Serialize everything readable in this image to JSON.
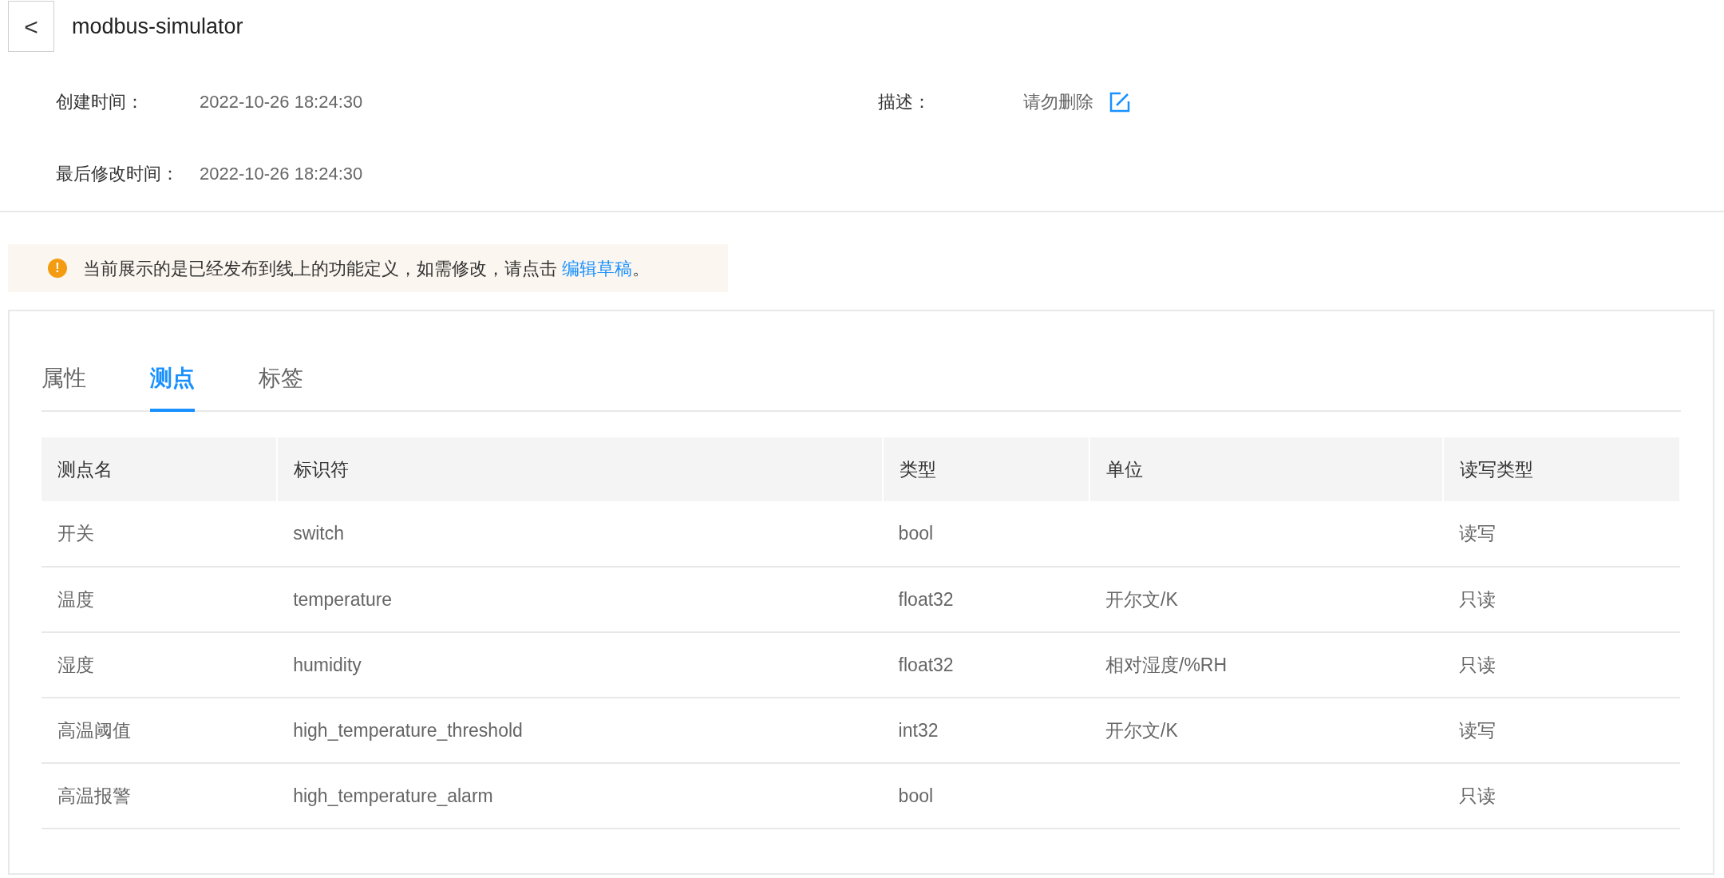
{
  "header": {
    "back_button": "<",
    "title": "modbus-simulator"
  },
  "info": [
    {
      "label": "创建时间：",
      "value": "2022-10-26 18:24:30"
    },
    {
      "label": "描述：",
      "value": "请勿删除",
      "editable": true
    },
    {
      "label": "最后修改时间：",
      "value": "2022-10-26 18:24:30"
    }
  ],
  "notice": {
    "icon": "!",
    "text": "当前展示的是已经发布到线上的功能定义，如需修改，请点击 ",
    "link": "编辑草稿",
    "suffix": "。"
  },
  "tabs": [
    {
      "label": "属性",
      "selected": false
    },
    {
      "label": "测点",
      "selected": true
    },
    {
      "label": "标签",
      "selected": false
    }
  ],
  "table": {
    "columns": [
      "测点名",
      "标识符",
      "类型",
      "单位",
      "读写类型"
    ],
    "rows": [
      [
        "开关",
        "switch",
        "bool",
        "",
        "读写"
      ],
      [
        "温度",
        "temperature",
        "float32",
        "开尔文/K",
        "只读"
      ],
      [
        "湿度",
        "humidity",
        "float32",
        "相对湿度/%RH",
        "只读"
      ],
      [
        "高温阈值",
        "high_temperature_threshold",
        "int32",
        "开尔文/K",
        "读写"
      ],
      [
        "高温报警",
        "high_temperature_alarm",
        "bool",
        "",
        "只读"
      ]
    ]
  }
}
